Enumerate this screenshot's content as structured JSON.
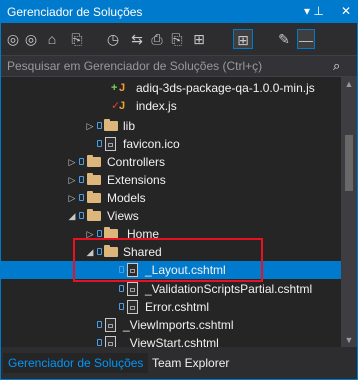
{
  "window": {
    "title": "Gerenciador de Soluções",
    "pin_glyph": "▾ ⊥",
    "close_glyph": "✕"
  },
  "toolbar": {
    "back": "◎",
    "forward": "◎",
    "home": "⌂",
    "switch_views": "⎘",
    "history": "◷",
    "sync": "⇆",
    "properties": "⎙",
    "copy": "⎘",
    "preview": "⊞",
    "wrench": "✎",
    "collapse": "—"
  },
  "search": {
    "placeholder": "Pesquisar em Gerenciador de Soluções (Ctrl+ç)",
    "icon": "⌕"
  },
  "tree": {
    "items": [
      {
        "label": "adiq-3ds-package-qa-1.0.0-min.js",
        "kind": "js",
        "marker": "+"
      },
      {
        "label": "index.js",
        "kind": "js",
        "marker": "✓"
      },
      {
        "label": "lib",
        "kind": "folder",
        "arrow": "▷"
      },
      {
        "label": "favicon.ico",
        "kind": "file"
      },
      {
        "label": "Controllers",
        "kind": "folder",
        "arrow": "▷"
      },
      {
        "label": "Extensions",
        "kind": "folder",
        "arrow": "▷"
      },
      {
        "label": "Models",
        "kind": "folder",
        "arrow": "▷"
      },
      {
        "label": "Views",
        "kind": "folder",
        "arrow": "◢"
      },
      {
        "label": "Home",
        "kind": "folder",
        "arrow": "▷"
      },
      {
        "label": "Shared",
        "kind": "folder",
        "arrow": "◢"
      },
      {
        "label": "_Layout.cshtml",
        "kind": "file",
        "selected": true
      },
      {
        "label": "_ValidationScriptsPartial.cshtml",
        "kind": "file"
      },
      {
        "label": "Error.cshtml",
        "kind": "file"
      },
      {
        "label": "_ViewImports.cshtml",
        "kind": "file"
      },
      {
        "label": "_ViewStart.cshtml",
        "kind": "file"
      }
    ]
  },
  "tabs": [
    {
      "label": "Gerenciador de Soluções",
      "active": true
    },
    {
      "label": "Team Explorer",
      "active": false
    }
  ],
  "colors": {
    "accent": "#007acc",
    "folder": "#dcb67a",
    "highlight": "#e81123",
    "background": "#252526"
  }
}
